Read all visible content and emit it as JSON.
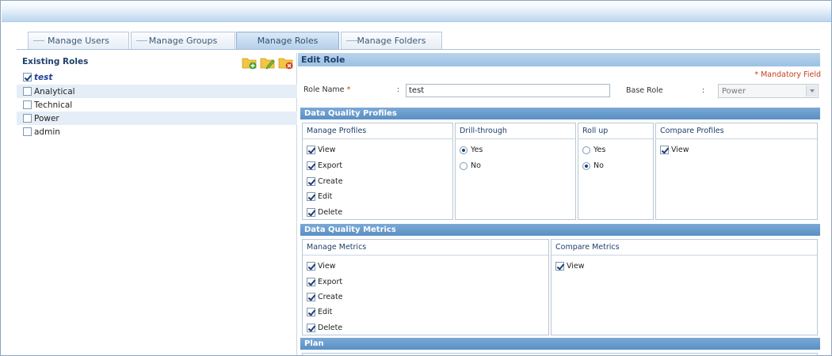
{
  "tabs": [
    {
      "label": "Manage Users",
      "active": false
    },
    {
      "label": "Manage Groups",
      "active": false
    },
    {
      "label": "Manage Roles",
      "active": true
    },
    {
      "label": "Manage Folders",
      "active": false
    }
  ],
  "left": {
    "title": "Existing Roles",
    "toolbar_icons": [
      "add-folder-icon",
      "edit-folder-icon",
      "delete-folder-icon"
    ],
    "roles": [
      {
        "label": "test",
        "checked": true,
        "selected": true
      },
      {
        "label": "Analytical",
        "checked": false
      },
      {
        "label": "Technical",
        "checked": false
      },
      {
        "label": "Power",
        "checked": false
      },
      {
        "label": "admin",
        "checked": false
      }
    ]
  },
  "edit": {
    "title": "Edit Role",
    "mandatory": "* Mandatory Field",
    "role_name_label": "Role Name",
    "role_name_star": "*",
    "colon": ":",
    "role_name_value": "test",
    "base_role_label": "Base Role",
    "base_role_value": "Power"
  },
  "profiles": {
    "title": "Data Quality Profiles",
    "manage": {
      "title": "Manage Profiles",
      "items": [
        "View",
        "Export",
        "Create",
        "Edit",
        "Delete"
      ]
    },
    "drill": {
      "title": "Drill-through",
      "options": [
        "Yes",
        "No"
      ],
      "selected": "Yes"
    },
    "rollup": {
      "title": "Roll up",
      "options": [
        "Yes",
        "No"
      ],
      "selected": "No"
    },
    "compare": {
      "title": "Compare Profiles",
      "items": [
        "View"
      ]
    }
  },
  "metrics": {
    "title": "Data Quality Metrics",
    "manage": {
      "title": "Manage Metrics",
      "items": [
        "View",
        "Export",
        "Create",
        "Edit",
        "Delete"
      ]
    },
    "compare": {
      "title": "Compare Metrics",
      "items": [
        "View"
      ]
    }
  },
  "plan": {
    "title": "Plan"
  },
  "colors": {
    "accent": "#5a8fc4",
    "header": "#9cc1e4",
    "mandatory": "#c5401f"
  }
}
